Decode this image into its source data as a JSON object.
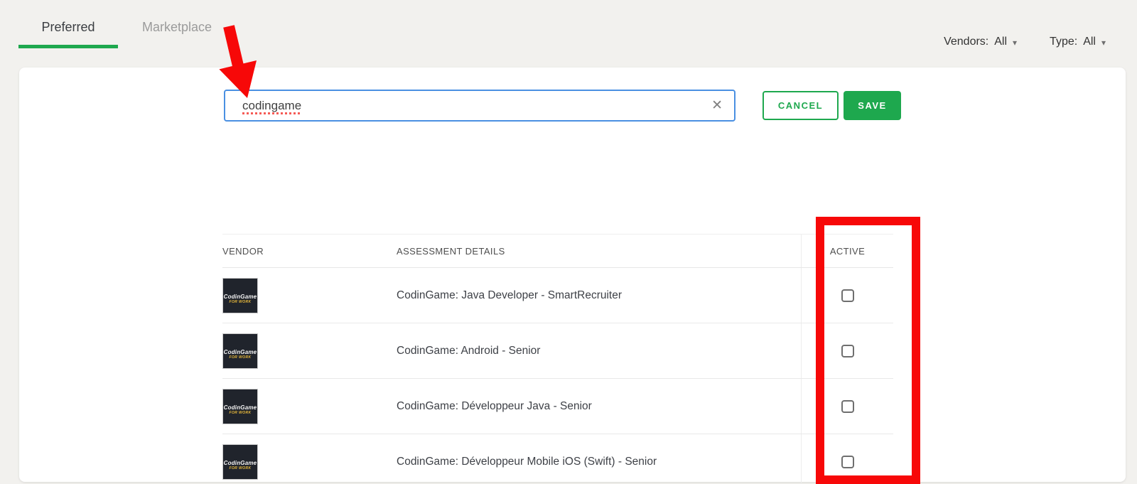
{
  "tabs": [
    {
      "label": "Preferred",
      "active": true
    },
    {
      "label": "Marketplace",
      "active": false
    }
  ],
  "filters": {
    "vendors_label": "Vendors:",
    "vendors_value": "All",
    "type_label": "Type:",
    "type_value": "All",
    "caret": "▾"
  },
  "search": {
    "value": "codingame",
    "clear_icon": "✕"
  },
  "actions": {
    "cancel_label": "CANCEL",
    "save_label": "SAVE"
  },
  "table": {
    "columns": [
      "VENDOR",
      "ASSESSMENT DETAILS",
      "ACTIVE"
    ],
    "vendor_logo": {
      "line1": "CodinGame",
      "line2": "FOR WORK"
    },
    "rows": [
      {
        "title": "CodinGame: Java Developer - SmartRecruiter",
        "active": false
      },
      {
        "title": "CodinGame: Android - Senior",
        "active": false
      },
      {
        "title": "CodinGame: Développeur Java - Senior",
        "active": false
      },
      {
        "title": "CodinGame: Développeur Mobile iOS (Swift) - Senior",
        "active": false
      }
    ]
  },
  "colors": {
    "accent_green": "#1ea84e",
    "annotation_red": "#f70808",
    "search_border_blue": "#4a90e2"
  },
  "annotations": {
    "arrow": "red arrow pointing at search input",
    "rectangle": "red rectangle highlighting ACTIVE column"
  }
}
